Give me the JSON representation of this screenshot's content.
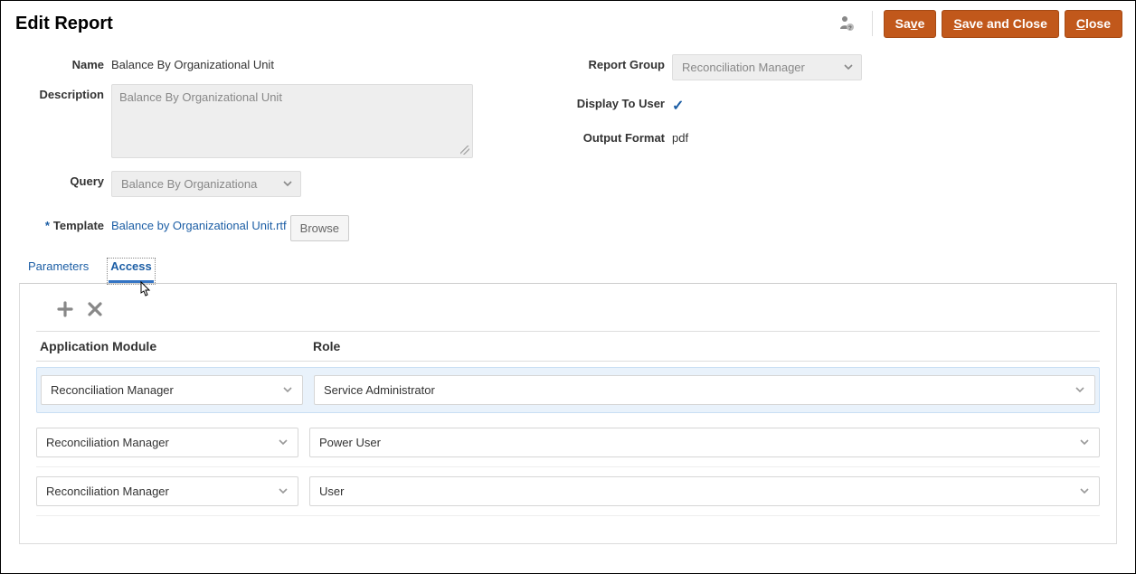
{
  "header": {
    "title": "Edit Report",
    "save": "Save",
    "save_close": "Save and Close",
    "close": "Close"
  },
  "form": {
    "name_label": "Name",
    "name_value": "Balance By Organizational Unit",
    "description_label": "Description",
    "description_value": "Balance By Organizational Unit",
    "query_label": "Query",
    "query_value": "Balance By Organizationa",
    "template_label": "Template",
    "template_value": "Balance by Organizational Unit.rtf",
    "browse": "Browse",
    "report_group_label": "Report Group",
    "report_group_value": "Reconciliation Manager",
    "display_to_user_label": "Display To User",
    "output_format_label": "Output Format",
    "output_format_value": "pdf"
  },
  "tabs": {
    "parameters": "Parameters",
    "access": "Access"
  },
  "access": {
    "col_app": "Application Module",
    "col_role": "Role",
    "rows": [
      {
        "app": "Reconciliation Manager",
        "role": "Service Administrator"
      },
      {
        "app": "Reconciliation Manager",
        "role": "Power User"
      },
      {
        "app": "Reconciliation Manager",
        "role": "User"
      }
    ]
  }
}
